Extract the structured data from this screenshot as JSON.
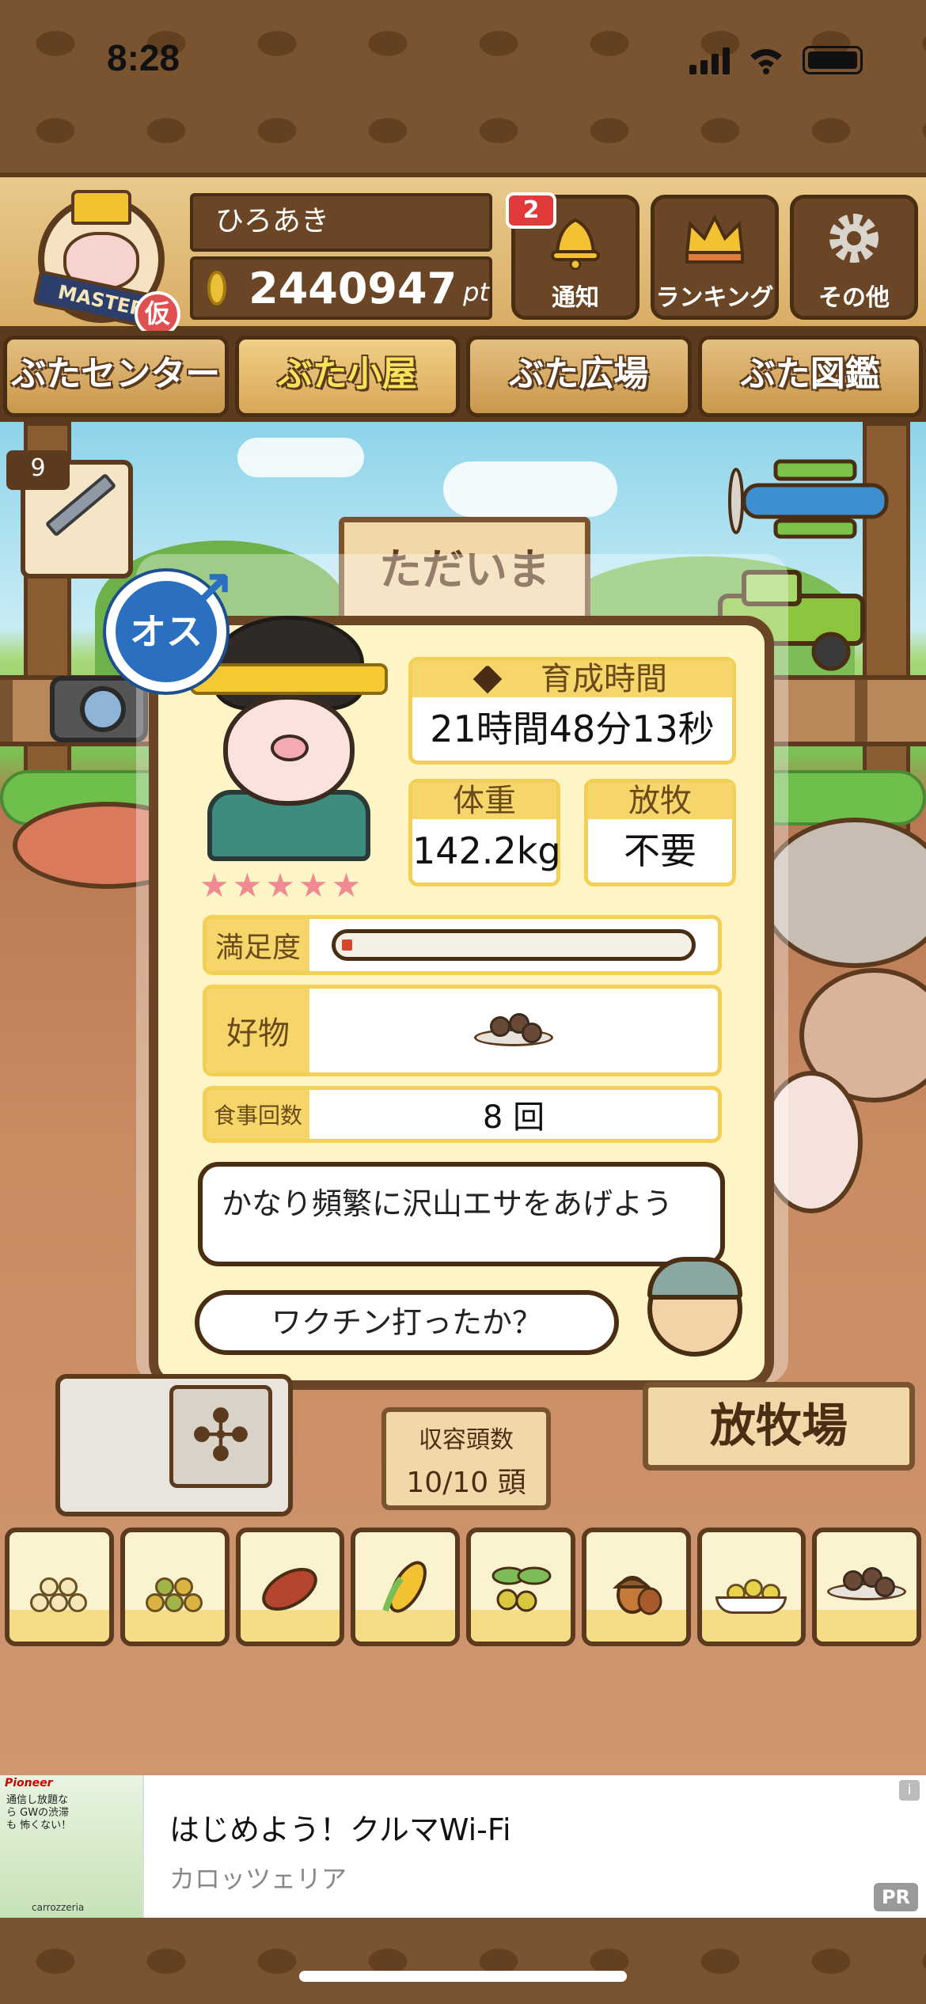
{
  "status_bar": {
    "time": "8:28"
  },
  "header": {
    "avatar_ribbon": "MASTER",
    "avatar_badge": "仮",
    "user_name": "ひろあき",
    "points": "2440947",
    "points_unit": "pt",
    "buttons": [
      {
        "label": "通知",
        "icon": "bell-icon",
        "badge": "2"
      },
      {
        "label": "ランキング",
        "icon": "crown-icon"
      },
      {
        "label": "その他",
        "icon": "gear-icon"
      }
    ]
  },
  "nav": {
    "tabs": [
      {
        "label": "ぶたセンター",
        "active": false
      },
      {
        "label": "ぶた小屋",
        "active": true
      },
      {
        "label": "ぶた広場",
        "active": false
      },
      {
        "label": "ぶた図鑑",
        "active": false
      }
    ]
  },
  "scene": {
    "vaccine_count": "9",
    "sign_text": "ただいま"
  },
  "pig_info": {
    "gender": "オス",
    "rating_stars": 5,
    "stars_text": "★★★★★",
    "growth_time_label": "育成時間",
    "growth_time_value": "21時間48分13秒",
    "weight_label": "体重",
    "weight_value": "142.2kg",
    "grazing_label": "放牧",
    "grazing_value": "不要",
    "satisfaction_label": "満足度",
    "satisfaction_level": 0.03,
    "favorite_label": "好物",
    "favorite_icon": "meatball-plate-icon",
    "meals_label": "食事回数",
    "meals_value": "8 回",
    "advice": "かなり頻繁に沢山エサをあげよう",
    "farmer_speech": "ワクチン打ったか？"
  },
  "bottom_scene": {
    "capacity_label": "収容頭数",
    "capacity_value": "10/10 頭",
    "pasture_sign": "放牧場"
  },
  "food_bar": {
    "items": [
      {
        "name": "grain-pile-icon"
      },
      {
        "name": "mixed-grain-icon"
      },
      {
        "name": "sweet-potato-icon"
      },
      {
        "name": "corn-icon"
      },
      {
        "name": "olive-branch-icon"
      },
      {
        "name": "acorn-icon"
      },
      {
        "name": "soybean-bowl-icon"
      },
      {
        "name": "meatball-plate-icon"
      }
    ]
  },
  "ad": {
    "brand": "Pioneer",
    "thumb_text": "通信し放題なら GWの渋滞も 怖くない！",
    "thumb_footer": "carrozzeria",
    "title": "はじめよう！クルマWi-Fi",
    "subtitle": "カロッツェリア",
    "pr_label": "PR",
    "info_label": "i"
  },
  "colors": {
    "wood_dark": "#5b3a1d",
    "wood_light": "#e9c98c",
    "panel_yellow": "#f6d66a",
    "gender_blue": "#2b6fc0",
    "notification_red": "#e03a3a"
  }
}
